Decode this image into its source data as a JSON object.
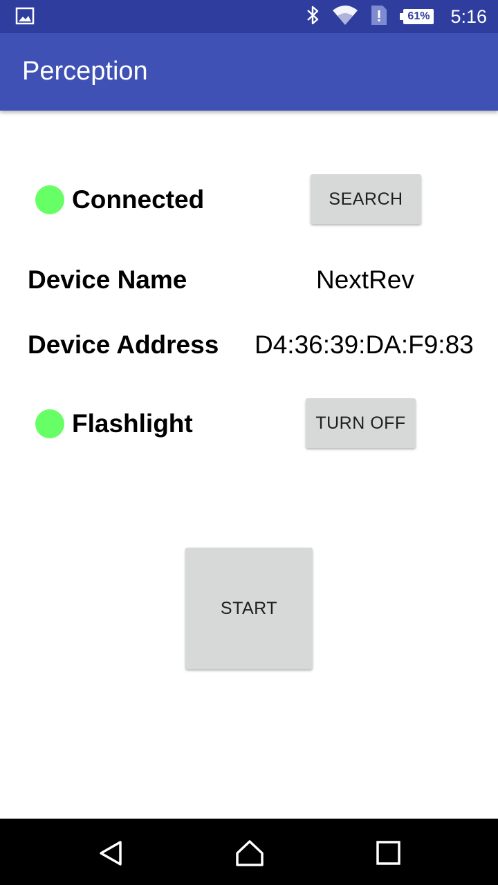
{
  "status_bar": {
    "time": "5:16",
    "battery_percent": "61%",
    "icons": [
      "image-icon",
      "bluetooth-icon",
      "wifi-icon",
      "sim-alert-icon",
      "battery-icon"
    ]
  },
  "app_bar": {
    "title": "Perception"
  },
  "connection": {
    "status_label": "Connected",
    "indicator_color": "#66ff66",
    "search_button": "SEARCH"
  },
  "device": {
    "name_label": "Device Name",
    "name_value": "NextRev",
    "address_label": "Device Address",
    "address_value": "D4:36:39:DA:F9:83"
  },
  "flashlight": {
    "label": "Flashlight",
    "indicator_color": "#66ff66",
    "toggle_button": "TURN OFF"
  },
  "start_button": "START",
  "nav_bar": {
    "icons": [
      "back-icon",
      "home-icon",
      "recents-icon"
    ]
  },
  "colors": {
    "primary": "#3f51b5",
    "primary_dark": "#2f3e9e",
    "button_bg": "#d7d8d8"
  }
}
